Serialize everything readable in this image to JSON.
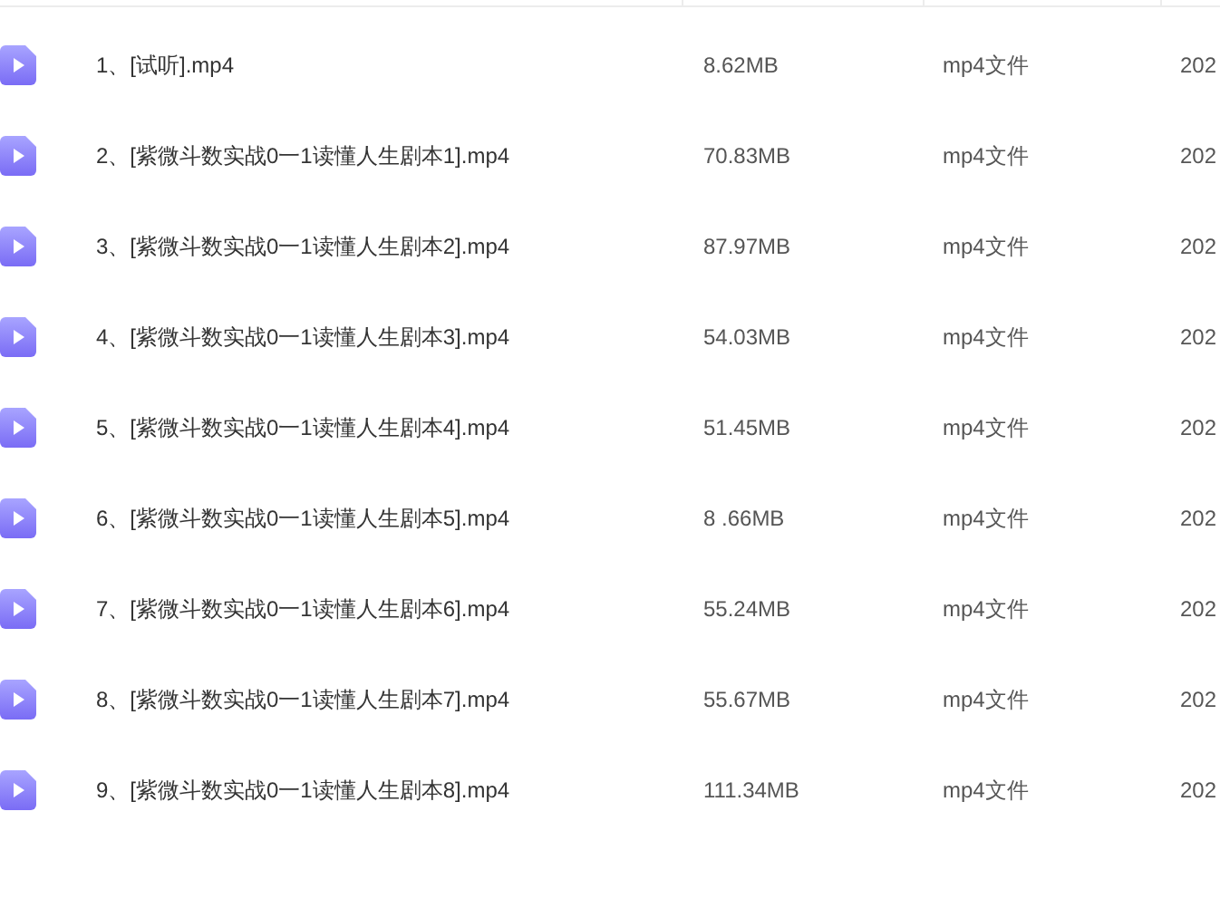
{
  "files": [
    {
      "name": "1、[试听].mp4",
      "size": "8.62MB",
      "type": "mp4文件",
      "date": "202"
    },
    {
      "name": "2、[紫微斗数实战0一1读懂人生剧本1].mp4",
      "size": "70.83MB",
      "type": "mp4文件",
      "date": "202"
    },
    {
      "name": "3、[紫微斗数实战0一1读懂人生剧本2].mp4",
      "size": "87.97MB",
      "type": "mp4文件",
      "date": "202"
    },
    {
      "name": "4、[紫微斗数实战0一1读懂人生剧本3].mp4",
      "size": "54.03MB",
      "type": "mp4文件",
      "date": "202"
    },
    {
      "name": "5、[紫微斗数实战0一1读懂人生剧本4].mp4",
      "size": "51.45MB",
      "type": "mp4文件",
      "date": "202"
    },
    {
      "name": "6、[紫微斗数实战0一1读懂人生剧本5].mp4",
      "size": "8 .66MB",
      "type": "mp4文件",
      "date": "202"
    },
    {
      "name": "7、[紫微斗数实战0一1读懂人生剧本6].mp4",
      "size": "55.24MB",
      "type": "mp4文件",
      "date": "202"
    },
    {
      "name": "8、[紫微斗数实战0一1读懂人生剧本7].mp4",
      "size": "55.67MB",
      "type": "mp4文件",
      "date": "202"
    },
    {
      "name": "9、[紫微斗数实战0一1读懂人生剧本8].mp4",
      "size": "111.34MB",
      "type": "mp4文件",
      "date": "202"
    }
  ]
}
